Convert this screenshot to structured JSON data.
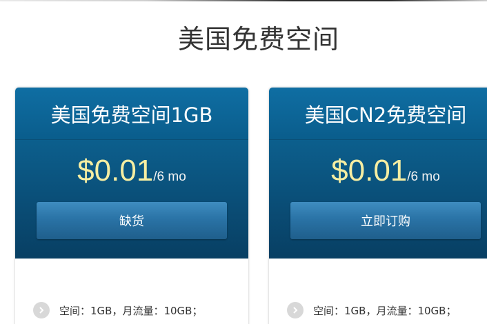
{
  "page_title": "美国免费空间",
  "plans": [
    {
      "name": "美国免费空间1GB",
      "price": "$0.01",
      "period": "/6 mo",
      "button_label": "缺货",
      "feature": "空间：1GB，月流量：10GB；"
    },
    {
      "name": "美国CN2免费空间",
      "price": "$0.01",
      "period": "/6 mo",
      "button_label": "立即订购",
      "feature": "空间：1GB，月流量：10GB；"
    }
  ],
  "colors": {
    "header_blue": "#0f6ea3",
    "price_yellow": "#f6eea2",
    "button_blue": "#2a73a6"
  },
  "icons": {
    "feature_bullet": "chevron-right-icon"
  }
}
